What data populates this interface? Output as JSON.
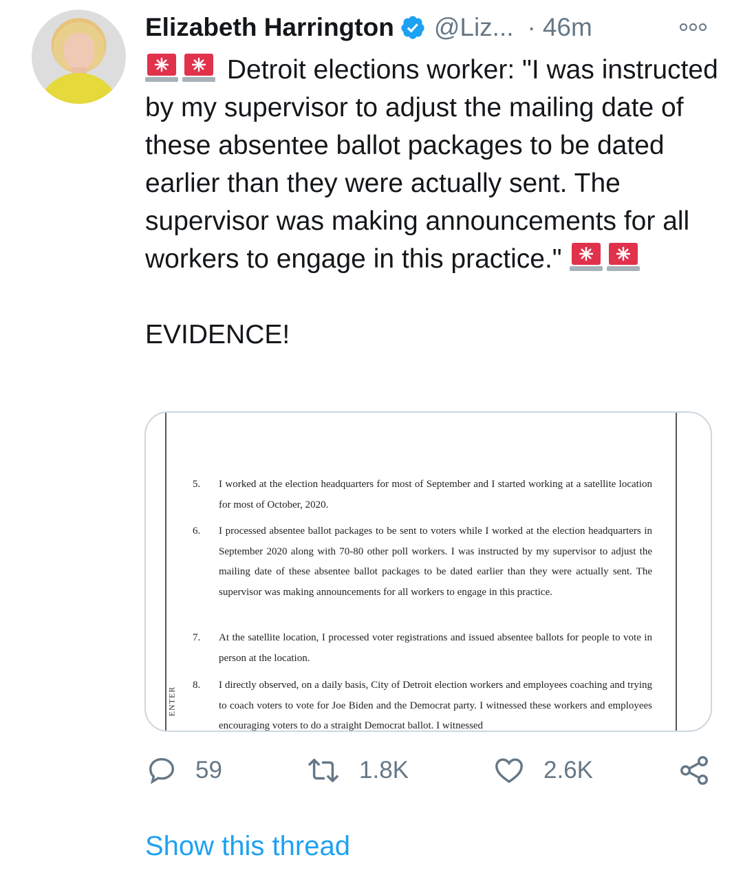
{
  "tweet": {
    "author_name": "Elizabeth Harrington",
    "handle": "@Liz...",
    "separator": "·",
    "time": "46m",
    "text_line1": "Detroit elections worker: \"I was instructed by my supervisor to adjust the mailing date of these absentee ballot packages to be dated earlier than they were actually sent. The supervisor was making announcements for all workers to engage in this practice.\"",
    "text_line2": "EVIDENCE!",
    "icons": {
      "verified": "verified-badge-icon",
      "siren": "rotating-light-emoji",
      "more": "more-options-icon"
    }
  },
  "media": {
    "side_label": "ENTER",
    "paragraphs": [
      {
        "num": "5.",
        "text": "I worked at the election headquarters for most of September and I started working at a satellite location for most of October, 2020."
      },
      {
        "num": "6.",
        "text": "I processed absentee ballot packages to be sent to voters while I worked at the election headquarters in September 2020 along with 70-80 other poll workers. I was instructed by my supervisor to adjust the mailing date of these absentee ballot packages to be dated earlier than they were actually sent. The supervisor was making announcements for all workers to engage in this practice."
      },
      {
        "num": "7.",
        "text": "At the satellite location, I processed voter registrations and issued absentee ballots for people to vote in person at the location."
      },
      {
        "num": "8.",
        "text": "I directly observed, on a daily basis, City of Detroit election workers and employees coaching and trying to coach voters to vote for Joe Biden and the Democrat party. I witnessed these workers and employees encouraging voters to do a straight Democrat ballot. I witnessed"
      }
    ]
  },
  "actions": {
    "reply_count": "59",
    "retweet_count": "1.8K",
    "like_count": "2.6K",
    "icons": {
      "reply": "reply-icon",
      "retweet": "retweet-icon",
      "like": "heart-icon",
      "share": "share-icon"
    }
  },
  "thread_link": "Show this thread",
  "colors": {
    "link": "#1da1f2",
    "muted": "#657786",
    "text": "#14171a",
    "verified": "#1da1f2",
    "siren": "#e0324b"
  }
}
